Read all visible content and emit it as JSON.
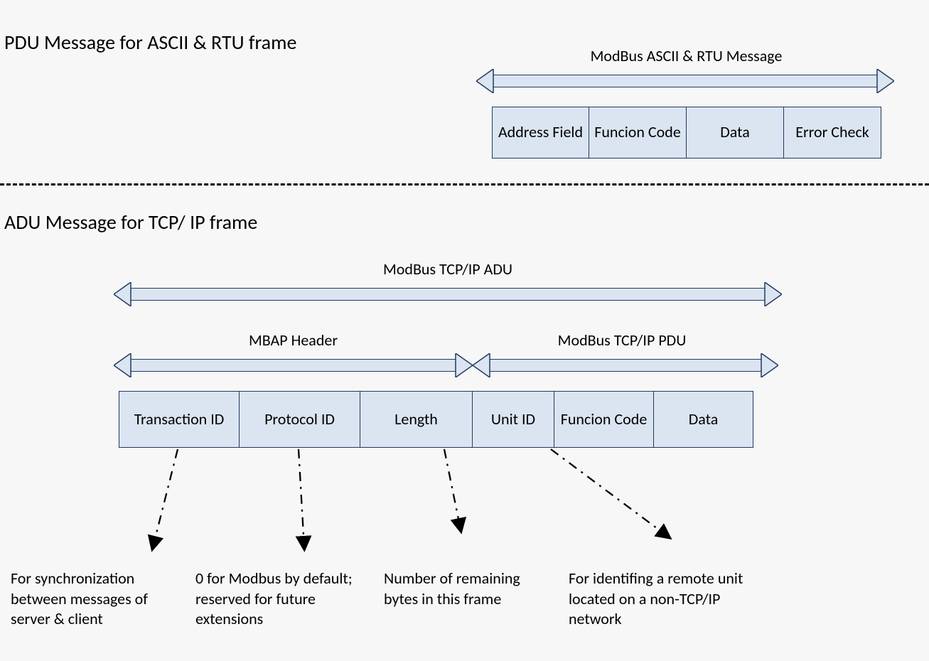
{
  "section1": {
    "title": "PDU Message for ASCII & RTU frame",
    "arrow_label": "ModBus ASCII & RTU Message",
    "fields": {
      "address": "Address Field",
      "func": "Funcion Code",
      "data": "Data",
      "error": "Error Check"
    }
  },
  "section2": {
    "title": "ADU Message for TCP/ IP frame",
    "arrow_adu": "ModBus TCP/IP ADU",
    "arrow_mbap": "MBAP Header",
    "arrow_pdu": "ModBus TCP/IP PDU",
    "fields": {
      "trans": "Transaction ID",
      "proto": "Protocol ID",
      "length": "Length",
      "unit": "Unit ID",
      "func": "Funcion Code",
      "data": "Data"
    },
    "notes": {
      "trans": "For synchronization between messages of server  & client",
      "proto": "0 for Modbus by default; reserved for future extensions",
      "length": "Number of remaining bytes in this frame",
      "unit": "For identifing a remote unit located on a non-TCP/IP network"
    }
  }
}
